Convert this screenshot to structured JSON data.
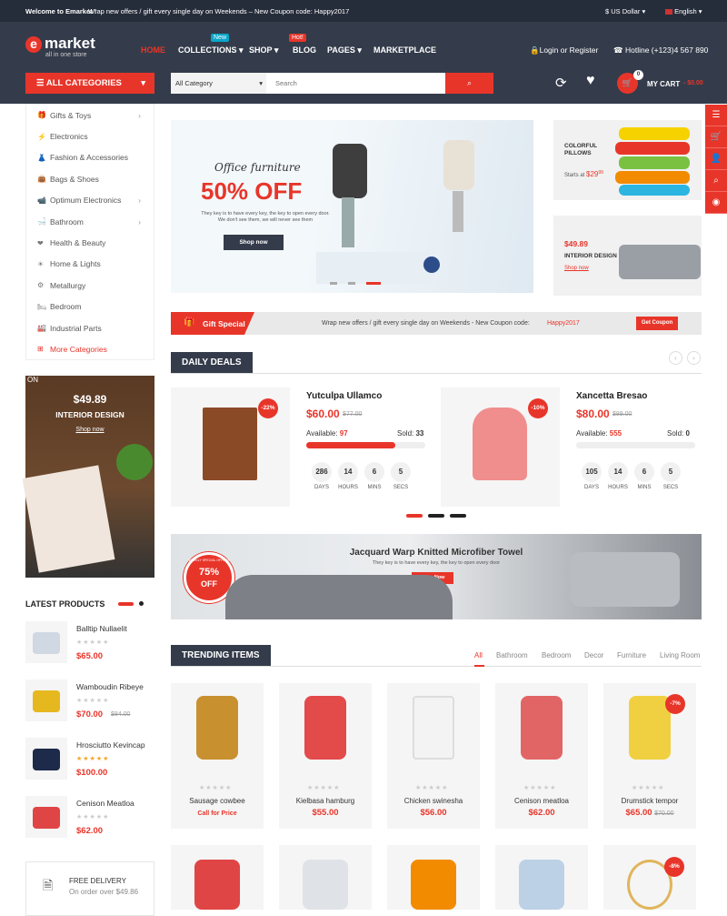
{
  "topbar": {
    "welcome": "Welcome to Emarket !",
    "promo": "Wrap new offers / gift every single day on Weekends – New Coupon code: Happy2017",
    "currency": "$ US Dollar",
    "language": "English"
  },
  "logo": {
    "name": "market",
    "letter": "e",
    "tagline": "all in one store"
  },
  "nav": {
    "home": "HOME",
    "collections": "COLLECTIONS",
    "new_badge": "New",
    "shop": "SHOP",
    "hot_badge": "Hot!",
    "blog": "BLOG",
    "pages": "PAGES",
    "marketplace": "MARKETPLACE"
  },
  "account": {
    "login": "Login or Register",
    "hotline": "Hotline (+123)4 567 890"
  },
  "search": {
    "category": "All Category",
    "placeholder": "Search"
  },
  "cart": {
    "label": "MY CART",
    "amount": "- $0.00",
    "count": "0"
  },
  "categories": {
    "title": "ALL CATEGORIES",
    "items": [
      "Gifts & Toys",
      "Electronics",
      "Fashion & Accessories",
      "Bags & Shoes",
      "Optimum Electronics",
      "Bathroom",
      "Health & Beauty",
      "Home & Lights",
      "Metallurgy",
      "Bedroom",
      "Industrial Parts"
    ],
    "more": "More Categories"
  },
  "hero": {
    "subtitle": "Office furniture",
    "headline": "50% OFF",
    "text1": "They key is to have every key, the key to open every door.",
    "text2": "We don't see them, we will never see them",
    "cta": "Shop now"
  },
  "promo_pillows": {
    "title1": "COLORFUL",
    "title2": "PILLOWS",
    "starts": "Starts at",
    "price": "$29",
    "price_sup": "99"
  },
  "promo_interior": {
    "price": "$49.89",
    "title": "INTERIOR DESIGN",
    "link": "Shop now"
  },
  "gift_bar": {
    "title": "Gift Special",
    "text": "Wrap new offers / gift every single day on Weekends - New Coupon code:",
    "code": "Happy2017",
    "cta": "Get Coupon"
  },
  "side_banner": {
    "tag": "ON",
    "price": "$49.89",
    "title": "INTERIOR DESIGN",
    "link": "Shop now"
  },
  "daily_deals": {
    "title": "DAILY DEALS",
    "deals": [
      {
        "name": "Yutculpa Ullamco",
        "price": "$60.00",
        "old": "$77.00",
        "available_label": "Available:",
        "available": "97",
        "sold_label": "Sold:",
        "sold": "33",
        "discount": "-22%",
        "progress": 0.75,
        "days": "286",
        "hours": "14",
        "mins": "6",
        "secs": "5"
      },
      {
        "name": "Xancetta Bresao",
        "price": "$80.00",
        "old": "$89.00",
        "available_label": "Available:",
        "available": "555",
        "sold_label": "Sold:",
        "sold": "0",
        "discount": "-10%",
        "progress": 0,
        "days": "105",
        "hours": "14",
        "mins": "6",
        "secs": "5"
      }
    ],
    "labels": {
      "days": "DAYS",
      "hours": "HOURS",
      "mins": "MINS",
      "secs": "SECS"
    }
  },
  "towel_banner": {
    "title": "Jacquard Warp Knitted Microfiber Towel",
    "text": "They key is to have every key, the key to open every door",
    "cta": "Shop Now",
    "badge_pct": "75%",
    "badge_off": "OFF",
    "badge_ring": "WEEKLY SPECIAL OFFERS"
  },
  "latest": {
    "title": "LATEST PRODUCTS",
    "items": [
      {
        "name": "Balltip Nullaelit",
        "price": "$65.00",
        "old": ""
      },
      {
        "name": "Wamboudin Ribeye",
        "price": "$70.00",
        "old": "$84.00"
      },
      {
        "name": "Hrosciutto Kevincap",
        "price": "$100.00",
        "old": ""
      },
      {
        "name": "Cenison Meatloa",
        "price": "$62.00",
        "old": ""
      }
    ]
  },
  "delivery": {
    "title": "FREE DELIVERY",
    "text": "On order over $49.86"
  },
  "trending": {
    "title": "TRENDING ITEMS",
    "tabs": [
      "All",
      "Bathroom",
      "Bedroom",
      "Decor",
      "Furniture",
      "Living Room"
    ],
    "items": [
      {
        "name": "Sausage cowbee",
        "price": "Call for Price",
        "old": "",
        "discount": ""
      },
      {
        "name": "Kielbasa hamburg",
        "price": "$55.00",
        "old": "",
        "discount": ""
      },
      {
        "name": "Chicken swinesha",
        "price": "$56.00",
        "old": "",
        "discount": ""
      },
      {
        "name": "Cenison meatloa",
        "price": "$62.00",
        "old": "",
        "discount": ""
      },
      {
        "name": "Drumstick tempor",
        "price": "$65.00",
        "old": "$70.00",
        "discount": "-7%"
      }
    ],
    "row2_discount": "-8%"
  },
  "colors": {
    "accent": "#e8352a",
    "dark": "#343c4b",
    "topbar": "#262d3a"
  }
}
